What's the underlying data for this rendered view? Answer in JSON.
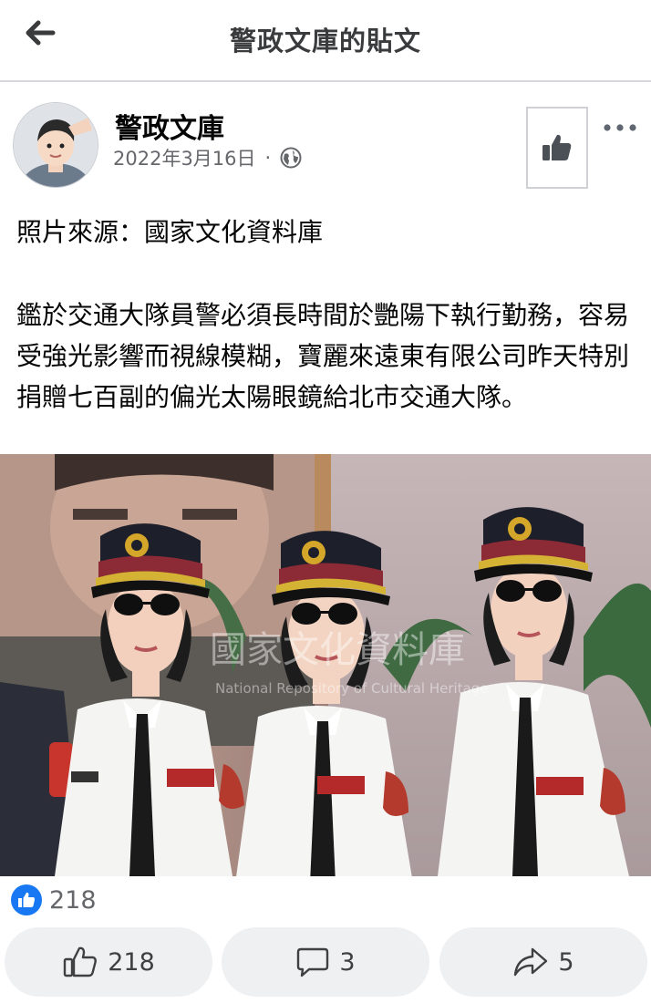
{
  "header": {
    "title": "警政文庫的貼文",
    "back_icon": "arrow-left-icon"
  },
  "post": {
    "author": "警政文庫",
    "date": "2022年3月16日",
    "separator": "·",
    "privacy_icon": "globe-icon",
    "text_source": "照片來源：國家文化資料庫",
    "text_body": "鑑於交通大隊員警必須長時間於艷陽下執行勤務，容易受強光影響而視線模糊，寶麗來遠東有限公司昨天特別捐贈七百副的偏光太陽眼鏡給北市交通大隊。",
    "photo_watermark": "國家文化資料庫",
    "photo_watermark_sub": "National Repository of Cultural Heritage"
  },
  "reactions": {
    "count": "218",
    "icon": "like-reaction-icon"
  },
  "actions": {
    "like_count": "218",
    "comment_count": "3",
    "share_count": "5"
  },
  "colors": {
    "like_blue": "#1877f2",
    "button_bg": "#eff0f2",
    "secondary_text": "#65676b"
  }
}
